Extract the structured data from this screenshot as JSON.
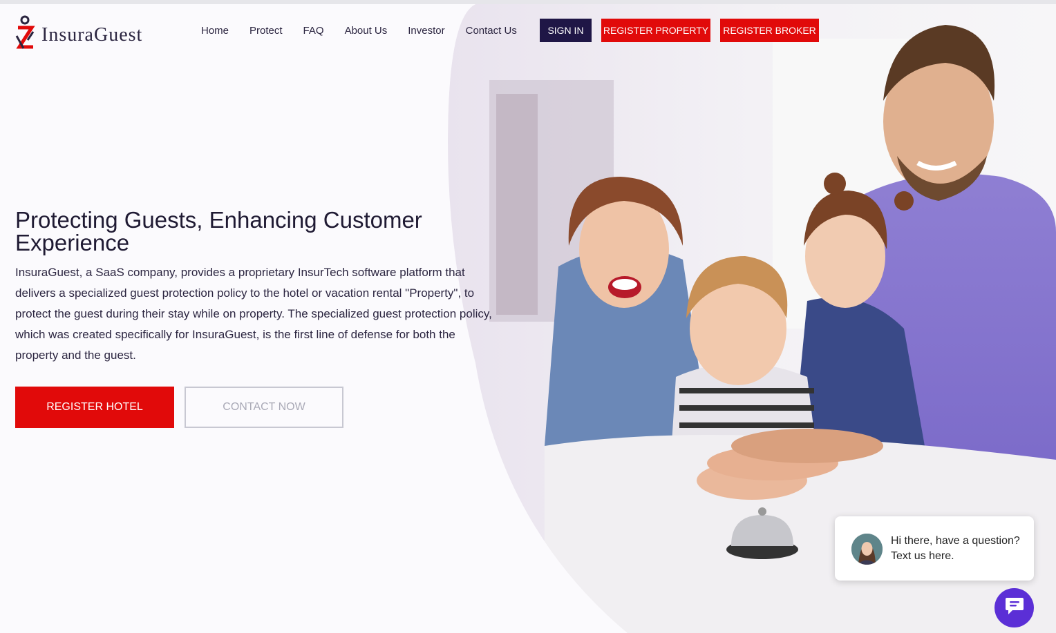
{
  "brand": {
    "name": "InsuraGuest"
  },
  "nav": {
    "items": [
      "Home",
      "Protect",
      "FAQ",
      "About Us",
      "Investor",
      "Contact Us"
    ]
  },
  "header_buttons": {
    "sign_in": "SIGN IN",
    "register_property": "REGISTER PROPERTY",
    "register_broker": "REGISTER BROKER"
  },
  "hero": {
    "title": "Protecting Guests, Enhancing Customer Experience",
    "description": "InsuraGuest, a SaaS company, provides a proprietary InsurTech software platform that delivers a specialized guest protection policy to the hotel or vacation rental \"Property\", to protect the guest during their stay while on property. The specialized guest protection policy, which was created specifically for InsuraGuest, is the first line of defense for both the property and the guest.",
    "primary_button": "REGISTER HOTEL",
    "secondary_button": "CONTACT NOW"
  },
  "chat": {
    "message": "Hi there, have a question? Text us here."
  },
  "colors": {
    "accent_red": "#e10a0a",
    "navy": "#1f1646",
    "chat_purple": "#5b2fd6"
  },
  "icons": {
    "chat": "chat-bubble-icon",
    "logo": "insuraguest-logo-icon"
  }
}
